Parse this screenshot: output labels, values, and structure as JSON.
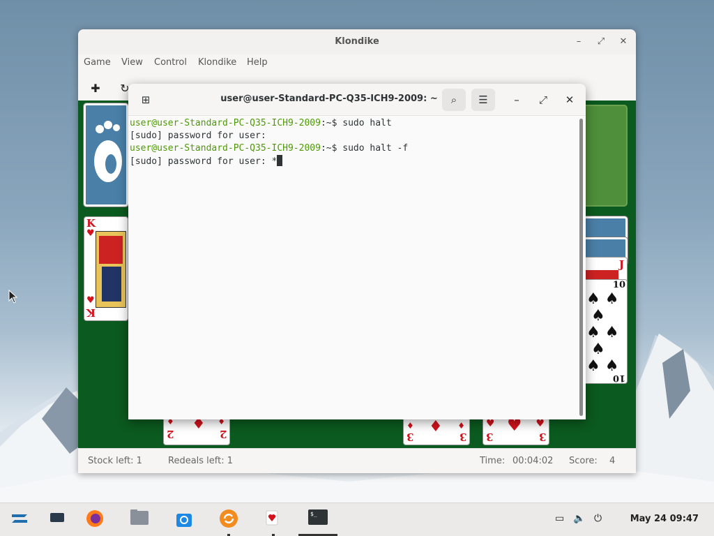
{
  "klondike": {
    "title": "Klondike",
    "menu": [
      "Game",
      "View",
      "Control",
      "Klondike",
      "Help"
    ],
    "status": {
      "stock": "Stock left: 1",
      "redeals": "Redeals left: 1",
      "time_label": "Time:",
      "time_value": "00:04:02",
      "score_label": "Score:",
      "score_value": "4"
    },
    "cards": {
      "king_rank": "K",
      "jack_rank": "J",
      "ten_rank": "10",
      "two_rank": "2",
      "three_rank": "3"
    }
  },
  "terminal": {
    "title": "user@user-Standard-PC-Q35-ICH9-2009: ~",
    "lines": [
      {
        "user": "user@user-Standard-PC-Q35-ICH9-2009",
        "rest": ":~$ sudo halt"
      },
      {
        "user": "",
        "rest": "[sudo] password for user:"
      },
      {
        "user": "user@user-Standard-PC-Q35-ICH9-2009",
        "rest": ":~$ sudo halt -f"
      },
      {
        "user": "",
        "rest": "[sudo] password for user: *"
      }
    ]
  },
  "taskbar": {
    "clock": "May 24  09:47"
  },
  "colors": {
    "felt": "#0b5a1f",
    "prompt_green": "#4e9a06",
    "card_red": "#d3121c"
  }
}
